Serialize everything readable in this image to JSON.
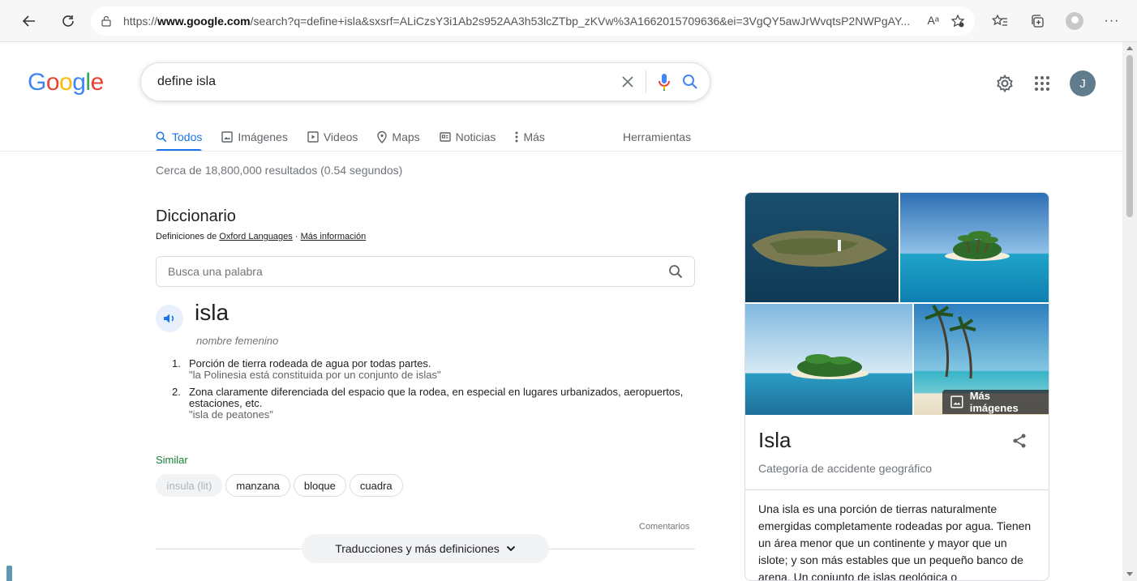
{
  "browser": {
    "url_prefix": "https://",
    "url_domain": "www.google.com",
    "url_rest": "/search?q=define+isla&sxsrf=ALiCzsY3i1Ab2s952AA3h53lcZTbp_zKVw%3A1662015709636&ei=3VgQY5awJrWvqtsP2NWPgAY...",
    "read_aloud_label": "Aᵃ"
  },
  "google": {
    "logo": [
      "G",
      "o",
      "o",
      "g",
      "l",
      "e"
    ],
    "logo_colors": [
      "#4285F4",
      "#EA4335",
      "#FBBC05",
      "#4285F4",
      "#34A853",
      "#EA4335"
    ],
    "query": "define isla",
    "avatar_letter": "J"
  },
  "tabs": {
    "items": [
      {
        "label": "Todos",
        "icon": "search-icon"
      },
      {
        "label": "Imágenes",
        "icon": "image-icon"
      },
      {
        "label": "Videos",
        "icon": "play-icon"
      },
      {
        "label": "Maps",
        "icon": "location-pin-icon"
      },
      {
        "label": "Noticias",
        "icon": "news-icon"
      },
      {
        "label": "Más",
        "icon": "more-vert-icon"
      }
    ],
    "tools": "Herramientas"
  },
  "result_stats": "Cerca de 18,800,000 resultados (0.54 segundos)",
  "dictionary": {
    "title": "Diccionario",
    "source_prefix": "Definiciones de",
    "source_link": "Oxford Languages",
    "separator": " · ",
    "more_info": "Más información",
    "search_placeholder": "Busca una palabra",
    "word": "isla",
    "part_of_speech": "nombre femenino",
    "definitions": [
      {
        "num": "1.",
        "text": "Porción de tierra rodeada de agua por todas partes.",
        "example": "\"la Polinesia está constituida por un conjunto de islas\""
      },
      {
        "num": "2.",
        "text": "Zona claramente diferenciada del espacio que la rodea, en especial en lugares urbanizados, aeropuertos, estaciones, etc.",
        "example": "\"isla de peatones\""
      }
    ],
    "similar_label": "Similar",
    "similar": [
      "ínsula (lit)",
      "manzana",
      "bloque",
      "cuadra"
    ],
    "feedback": "Comentarios",
    "more_defs": "Traducciones y más definiciones"
  },
  "knowledge_panel": {
    "title": "Isla",
    "subtitle": "Categoría de accidente geográfico",
    "more_images": "Más imágenes",
    "description": "Una isla es una porción de tierras naturalmente emergidas completamente rodeadas por agua. Tienen un área menor que un continente y mayor que un islote; y son más estables que un pequeño banco de arena. Un conjunto de islas geológica o"
  },
  "colors": {
    "accent": "#1a73e8",
    "similar": "#188038",
    "text": "#202124",
    "muted": "#70757a"
  }
}
